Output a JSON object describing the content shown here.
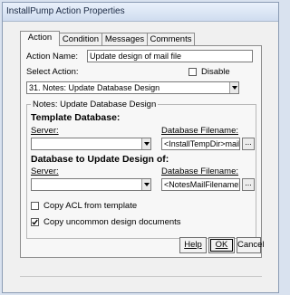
{
  "window": {
    "title": "InstallPump Action Properties"
  },
  "tabs": [
    {
      "label": "Action",
      "active": true
    },
    {
      "label": "Condition",
      "active": false
    },
    {
      "label": "Messages",
      "active": false
    },
    {
      "label": "Comments",
      "active": false
    }
  ],
  "action": {
    "name_label": "Action Name:",
    "name_value": "Update design of mail file",
    "select_label": "Select Action:",
    "disable_label": "Disable",
    "disable_checked": false,
    "selected_action": "31. Notes: Update Database Design"
  },
  "group": {
    "caption": "Notes: Update Database Design",
    "template": {
      "heading": "Template Database:",
      "server_label": "Server:",
      "server_value": "",
      "filename_label": "Database Filename:",
      "filename_value": "<InstallTempDir>mail.ntf",
      "browse_label": "..."
    },
    "target": {
      "heading": "Database to Update Design of:",
      "server_label": "Server:",
      "server_value": "",
      "filename_label": "Database Filename:",
      "filename_value": "<NotesMailFilename>",
      "browse_label": "..."
    },
    "copy_acl": {
      "label": "Copy ACL from template",
      "checked": false
    },
    "copy_uncommon": {
      "label": "Copy uncommon design documents",
      "checked": true
    }
  },
  "buttons": {
    "help": "Help",
    "ok": "OK",
    "cancel": "Cancel"
  },
  "icons": {
    "dropdown": "chevron-down-icon",
    "check": "checkmark-icon"
  }
}
